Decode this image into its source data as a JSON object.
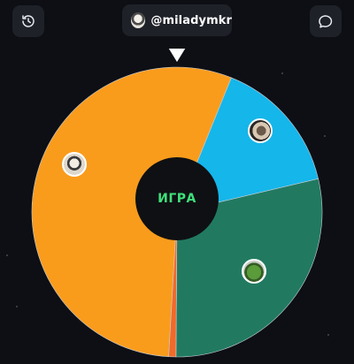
{
  "header": {
    "history_icon": "history-icon",
    "chat_icon": "chat-bubble-icon",
    "username": "@miladymkr"
  },
  "wheel": {
    "center_label": "ИГРА",
    "segments": [
      {
        "color": "#f99c1c",
        "share": 0.552,
        "avatar": "avatar-1"
      },
      {
        "color": "#15b6ea",
        "share": 0.152,
        "avatar": "avatar-2"
      },
      {
        "color": "#217a60",
        "share": 0.288,
        "avatar": "avatar-3"
      },
      {
        "color": "#f06a2a",
        "share": 0.008
      }
    ],
    "pointer_color": "#ffffff"
  }
}
